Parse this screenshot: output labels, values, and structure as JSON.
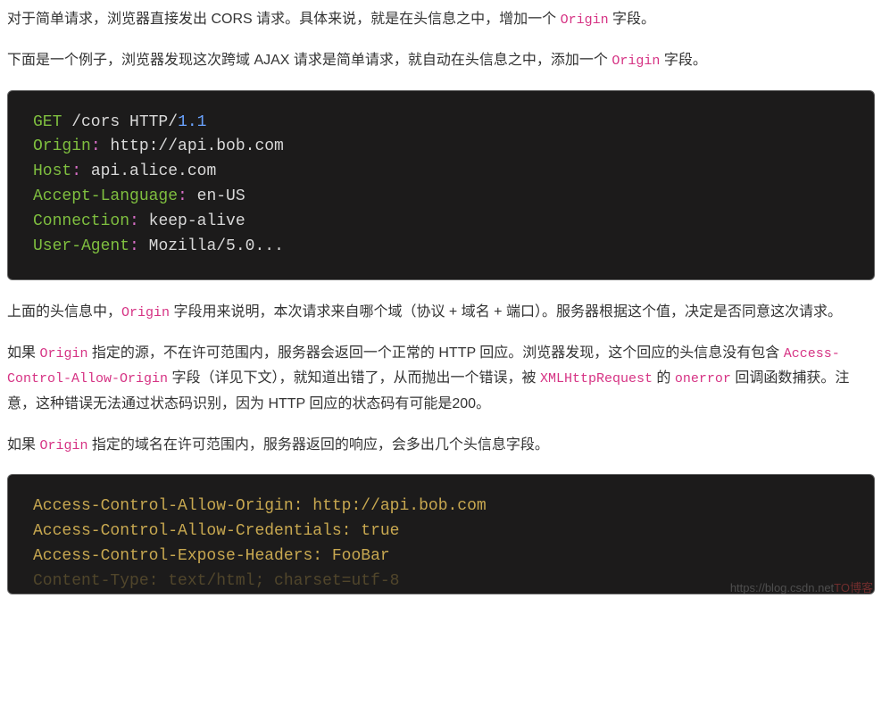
{
  "para1": {
    "t1": "对于简单请求，浏览器直接发出 CORS 请求。具体来说，就是在头信息之中，增加一个 ",
    "code": "Origin",
    "t2": " 字段。"
  },
  "para2": {
    "t1": "下面是一个例子，浏览器发现这次跨域 AJAX 请求是简单请求，就自动在头信息之中，添加一个 ",
    "code": "Origin",
    "t2": " 字段。"
  },
  "code1": {
    "l1": {
      "method": "GET",
      "path": " /cors ",
      "proto": "HTTP",
      "slash": "/",
      "ver": "1.1"
    },
    "l2": {
      "name": "Origin",
      "colon": ":",
      "value": " http://api.bob.com"
    },
    "l3": {
      "name": "Host",
      "colon": ":",
      "value": " api.alice.com"
    },
    "l4": {
      "name": "Accept-Language",
      "colon": ":",
      "value": " en-US"
    },
    "l5": {
      "name": "Connection",
      "colon": ":",
      "value": " keep-alive"
    },
    "l6": {
      "name": "User-Agent",
      "colon": ":",
      "value": " Mozilla/5.0..."
    }
  },
  "para3": {
    "t1": "上面的头信息中，",
    "code": "Origin",
    "t2": " 字段用来说明，本次请求来自哪个域（协议 + 域名 + 端口）。服务器根据这个值，决定是否同意这次请求。"
  },
  "para4": {
    "t1": "如果 ",
    "c1": "Origin",
    "t2": " 指定的源，不在许可范围内，服务器会返回一个正常的 HTTP 回应。浏览器发现，这个回应的头信息没有包含 ",
    "c2": "Access-Control-Allow-Origin",
    "t3": " 字段（详见下文），就知道出错了，从而抛出一个错误，被 ",
    "c3": "XMLHttpRequest",
    "t4": " 的 ",
    "c4": "onerror",
    "t5": " 回调函数捕获。注意，这种错误无法通过状态码识别，因为 HTTP 回应的状态码有可能是200。"
  },
  "para5": {
    "t1": "如果 ",
    "code": "Origin",
    "t2": " 指定的域名在许可范围内，服务器返回的响应，会多出几个头信息字段。"
  },
  "code2": {
    "l1": {
      "name": "Access-Control-Allow-Origin",
      "colon": ":",
      "value": " http://api.bob.com"
    },
    "l2": {
      "name": "Access-Control-Allow-Credentials",
      "colon": ":",
      "value": " true"
    },
    "l3": {
      "name": "Access-Control-Expose-Headers",
      "colon": ":",
      "value": " FooBar"
    },
    "l4": {
      "name": "Content-Type",
      "colon": ":",
      "value": " text/html; charset=utf-8"
    }
  },
  "watermark": {
    "url": "https://blog.csdn.net",
    "brand": "TO博客"
  }
}
